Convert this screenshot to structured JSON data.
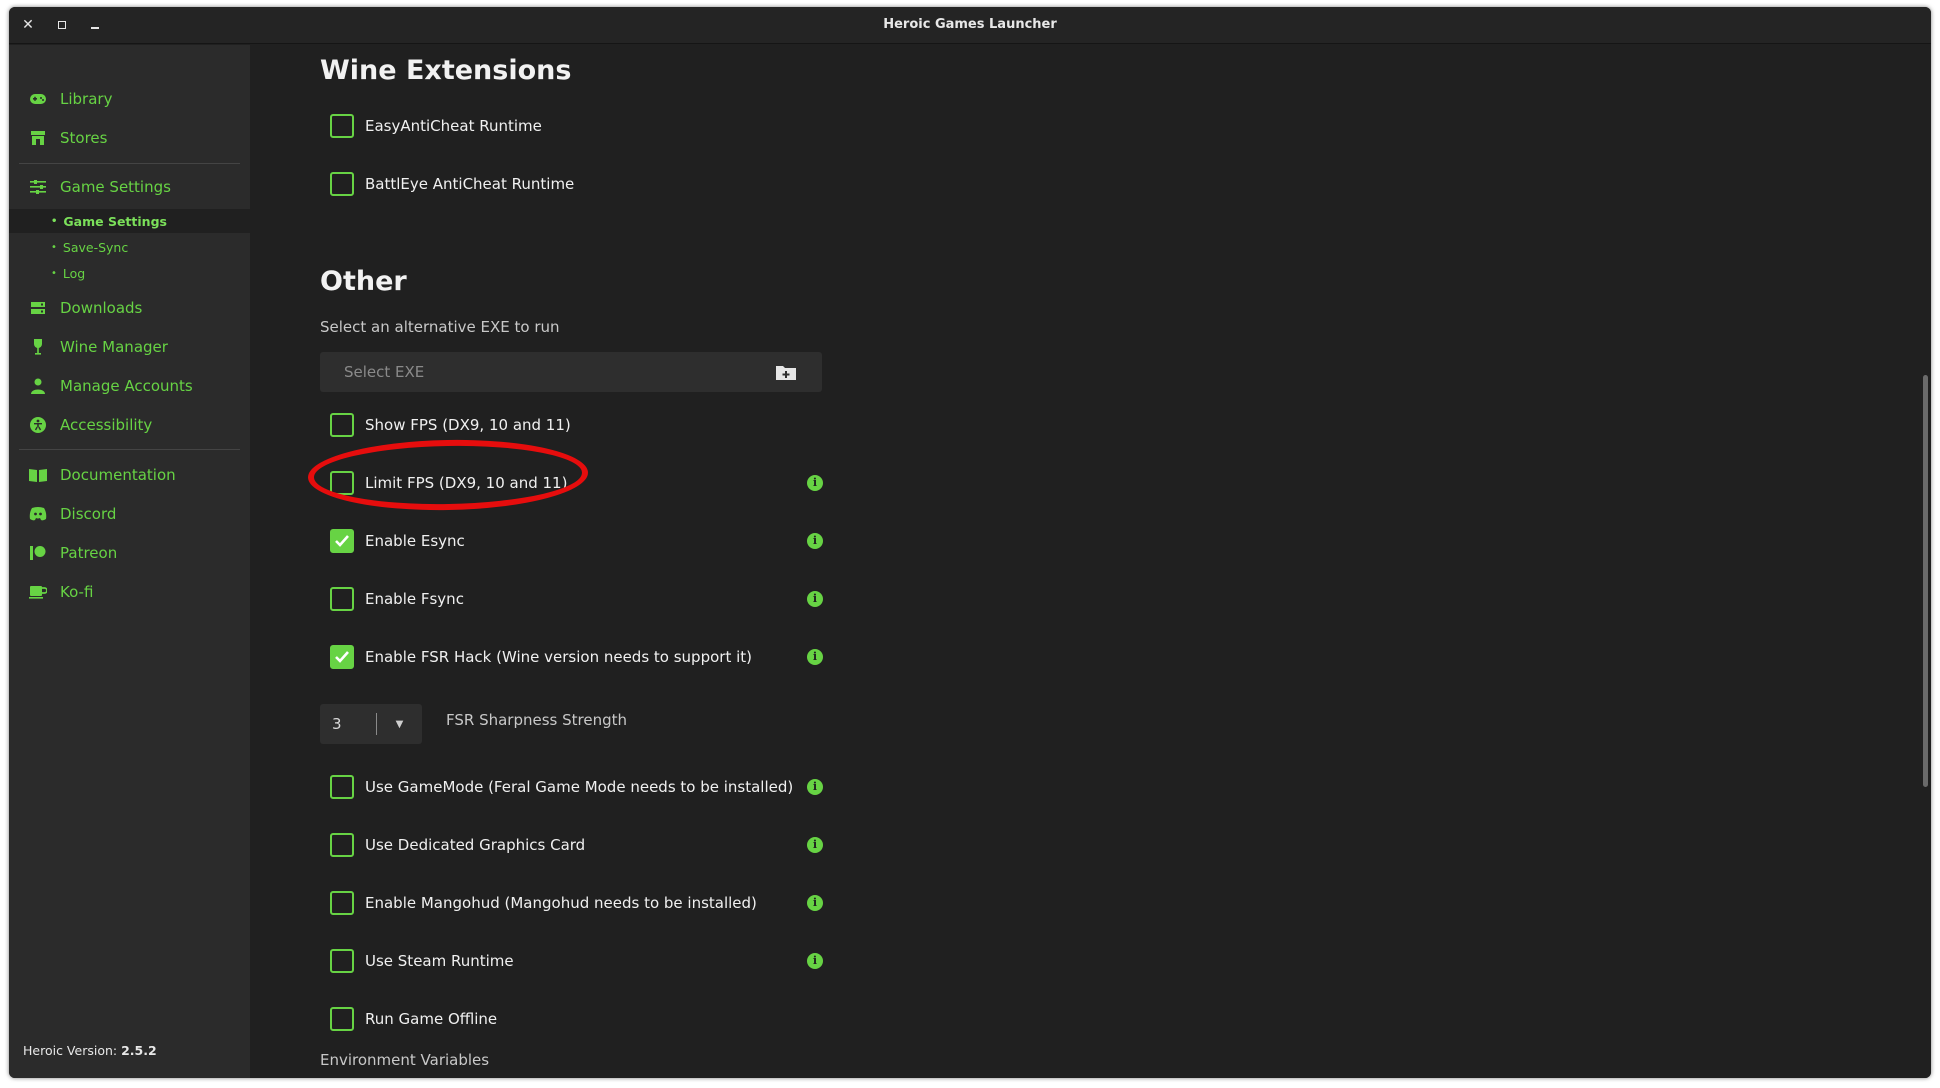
{
  "window": {
    "title": "Heroic Games Launcher"
  },
  "sidebar": {
    "items": [
      {
        "label": "Library",
        "icon": "gamepad-icon"
      },
      {
        "label": "Stores",
        "icon": "store-icon"
      },
      {
        "label": "Game Settings",
        "icon": "sliders-icon"
      },
      {
        "label": "Downloads",
        "icon": "downloads-icon"
      },
      {
        "label": "Wine Manager",
        "icon": "wine-glass-icon"
      },
      {
        "label": "Manage Accounts",
        "icon": "user-icon"
      },
      {
        "label": "Accessibility",
        "icon": "accessibility-icon"
      },
      {
        "label": "Documentation",
        "icon": "book-icon"
      },
      {
        "label": "Discord",
        "icon": "discord-icon"
      },
      {
        "label": "Patreon",
        "icon": "patreon-icon"
      },
      {
        "label": "Ko-fi",
        "icon": "coffee-cup-icon"
      }
    ],
    "sub_items": [
      {
        "label": "Game Settings",
        "current": true
      },
      {
        "label": "Save-Sync",
        "current": false
      },
      {
        "label": "Log",
        "current": false
      }
    ],
    "version_label": "Heroic Version:",
    "version_value": "2.5.2"
  },
  "settings": {
    "wine_extensions_title": "Wine Extensions",
    "easyanticheat_label": "EasyAntiCheat Runtime",
    "battleye_label": "BattlEye AntiCheat Runtime",
    "other_title": "Other",
    "alt_exe_label": "Select an alternative EXE to run",
    "select_exe_placeholder": "Select EXE",
    "show_fps_label": "Show FPS (DX9, 10 and 11)",
    "limit_fps_label": "Limit FPS (DX9, 10 and 11)",
    "esync_label": "Enable Esync",
    "fsync_label": "Enable Fsync",
    "fsr_hack_label": "Enable FSR Hack (Wine version needs to support it)",
    "fsr_sharpness_value": "3",
    "fsr_sharpness_label": "FSR Sharpness Strength",
    "gamemode_label": "Use GameMode (Feral Game Mode needs to be installed)",
    "dedicated_gpu_label": "Use Dedicated Graphics Card",
    "mangohud_label": "Enable Mangohud (Mangohud needs to be installed)",
    "steam_runtime_label": "Use Steam Runtime",
    "offline_label": "Run Game Offline",
    "env_vars_label": "Environment Variables",
    "info_glyph": "i"
  },
  "colors": {
    "accent": "#67d344",
    "annotation": "#e60d0d",
    "background": "#202020",
    "sidebar": "#2b2b2b"
  }
}
